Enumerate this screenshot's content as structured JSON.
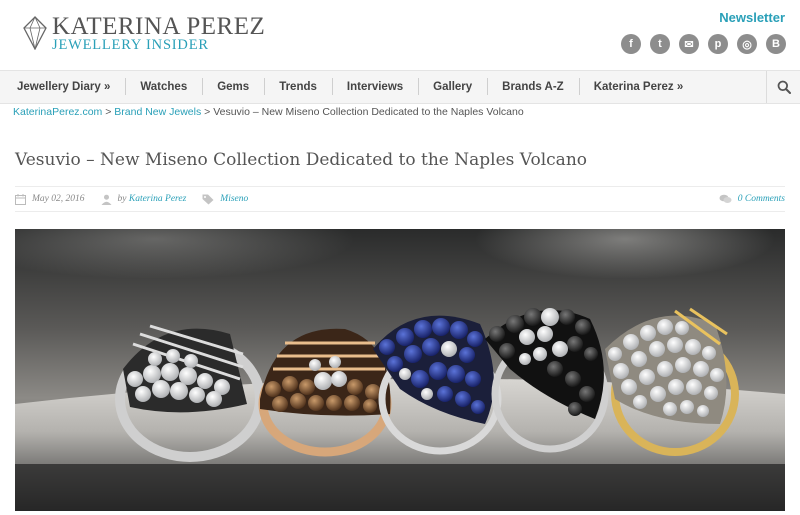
{
  "header": {
    "logo_name": "KATERINA PEREZ",
    "logo_tagline": "JEWELLERY INSIDER",
    "newsletter_label": "Newsletter",
    "socials": [
      {
        "icon": "facebook-icon",
        "glyph": "f"
      },
      {
        "icon": "twitter-icon",
        "glyph": "t"
      },
      {
        "icon": "email-icon",
        "glyph": "✉"
      },
      {
        "icon": "pinterest-icon",
        "glyph": "p"
      },
      {
        "icon": "instagram-icon",
        "glyph": "◎"
      },
      {
        "icon": "blog-icon",
        "glyph": "B"
      }
    ],
    "accent_color": "#2aa0b8"
  },
  "nav": {
    "items": [
      {
        "label": "Jewellery Diary »"
      },
      {
        "label": "Watches"
      },
      {
        "label": "Gems"
      },
      {
        "label": "Trends"
      },
      {
        "label": "Interviews"
      },
      {
        "label": "Gallery"
      },
      {
        "label": "Brands A-Z"
      },
      {
        "label": "Katerina Perez »"
      }
    ],
    "search_icon": "search-icon"
  },
  "breadcrumb": {
    "home": "KaterinaPerez.com",
    "sep1": " > ",
    "category": "Brand New Jewels",
    "sep2": " > ",
    "current": "Vesuvio – New Miseno Collection Dedicated to the Naples Volcano"
  },
  "article": {
    "title": "Vesuvio – New Miseno Collection Dedicated to the Naples Volcano",
    "date": "May 02, 2016",
    "by": "by",
    "author": "Katerina Perez",
    "tag": "Miseno",
    "comments": "0 Comments"
  }
}
